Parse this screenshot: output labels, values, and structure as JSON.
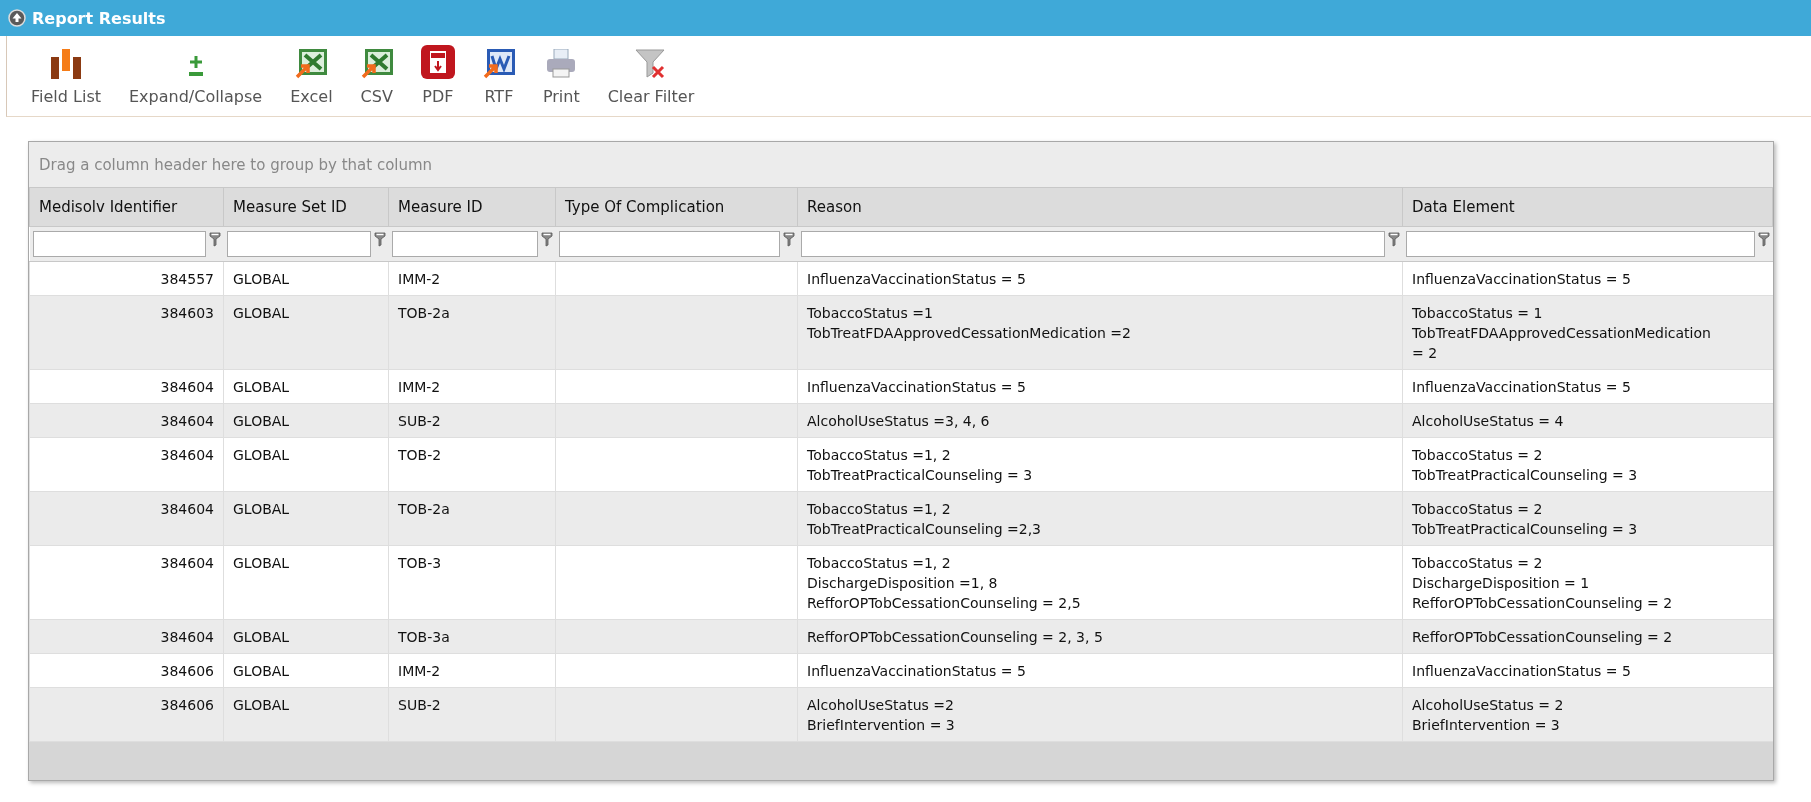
{
  "panel": {
    "title": "Report Results"
  },
  "toolbar": [
    {
      "label": "Field List",
      "kind": "fields"
    },
    {
      "label": "Expand/Collapse",
      "kind": "expand"
    },
    {
      "label": "Excel",
      "kind": "excel"
    },
    {
      "label": "CSV",
      "kind": "csv"
    },
    {
      "label": "PDF",
      "kind": "pdf"
    },
    {
      "label": "RTF",
      "kind": "rtf"
    },
    {
      "label": "Print",
      "kind": "print"
    },
    {
      "label": "Clear Filter",
      "kind": "clearfilter"
    }
  ],
  "grid": {
    "group_hint": "Drag a column header here to group by that column",
    "columns": [
      {
        "label": "Medisolv Identifier"
      },
      {
        "label": "Measure Set ID"
      },
      {
        "label": "Measure ID"
      },
      {
        "label": "Type Of Complication"
      },
      {
        "label": "Reason"
      },
      {
        "label": "Data Element"
      }
    ],
    "rows": [
      {
        "cells": [
          [
            "384557"
          ],
          [
            "GLOBAL"
          ],
          [
            "IMM-2"
          ],
          [],
          [
            "InfluenzaVaccinationStatus = 5"
          ],
          [
            "InfluenzaVaccinationStatus = 5"
          ]
        ]
      },
      {
        "cells": [
          [
            "384603"
          ],
          [
            "GLOBAL"
          ],
          [
            "TOB-2a"
          ],
          [],
          [
            "TobaccoStatus =1",
            "TobTreatFDAApprovedCessationMedication =2"
          ],
          [
            "TobaccoStatus = 1",
            "TobTreatFDAApprovedCessationMedication",
            "= 2"
          ]
        ]
      },
      {
        "cells": [
          [
            "384604"
          ],
          [
            "GLOBAL"
          ],
          [
            "IMM-2"
          ],
          [],
          [
            "InfluenzaVaccinationStatus = 5"
          ],
          [
            "InfluenzaVaccinationStatus = 5"
          ]
        ]
      },
      {
        "cells": [
          [
            "384604"
          ],
          [
            "GLOBAL"
          ],
          [
            "SUB-2"
          ],
          [],
          [
            "AlcoholUseStatus =3, 4, 6"
          ],
          [
            "AlcoholUseStatus = 4"
          ]
        ]
      },
      {
        "cells": [
          [
            "384604"
          ],
          [
            "GLOBAL"
          ],
          [
            "TOB-2"
          ],
          [],
          [
            "TobaccoStatus =1, 2",
            "TobTreatPracticalCounseling = 3"
          ],
          [
            "TobaccoStatus = 2",
            "TobTreatPracticalCounseling = 3"
          ]
        ]
      },
      {
        "cells": [
          [
            "384604"
          ],
          [
            "GLOBAL"
          ],
          [
            "TOB-2a"
          ],
          [],
          [
            "TobaccoStatus =1, 2",
            "TobTreatPracticalCounseling =2,3"
          ],
          [
            "TobaccoStatus = 2",
            "TobTreatPracticalCounseling = 3"
          ]
        ]
      },
      {
        "cells": [
          [
            "384604"
          ],
          [
            "GLOBAL"
          ],
          [
            "TOB-3"
          ],
          [],
          [
            "TobaccoStatus =1, 2",
            "DischargeDisposition =1, 8",
            "RefforOPTobCessationCounseling = 2,5"
          ],
          [
            "TobaccoStatus = 2",
            "DischargeDisposition = 1",
            "RefforOPTobCessationCounseling = 2"
          ]
        ]
      },
      {
        "cells": [
          [
            "384604"
          ],
          [
            "GLOBAL"
          ],
          [
            "TOB-3a"
          ],
          [],
          [
            "RefforOPTobCessationCounseling = 2, 3, 5"
          ],
          [
            "RefforOPTobCessationCounseling = 2"
          ]
        ]
      },
      {
        "cells": [
          [
            "384606"
          ],
          [
            "GLOBAL"
          ],
          [
            "IMM-2"
          ],
          [],
          [
            "InfluenzaVaccinationStatus = 5"
          ],
          [
            "InfluenzaVaccinationStatus = 5"
          ]
        ]
      },
      {
        "cells": [
          [
            "384606"
          ],
          [
            "GLOBAL"
          ],
          [
            "SUB-2"
          ],
          [],
          [
            "AlcoholUseStatus =2",
            "BriefIntervention = 3"
          ],
          [
            "AlcoholUseStatus = 2",
            "BriefIntervention = 3"
          ]
        ]
      }
    ]
  }
}
